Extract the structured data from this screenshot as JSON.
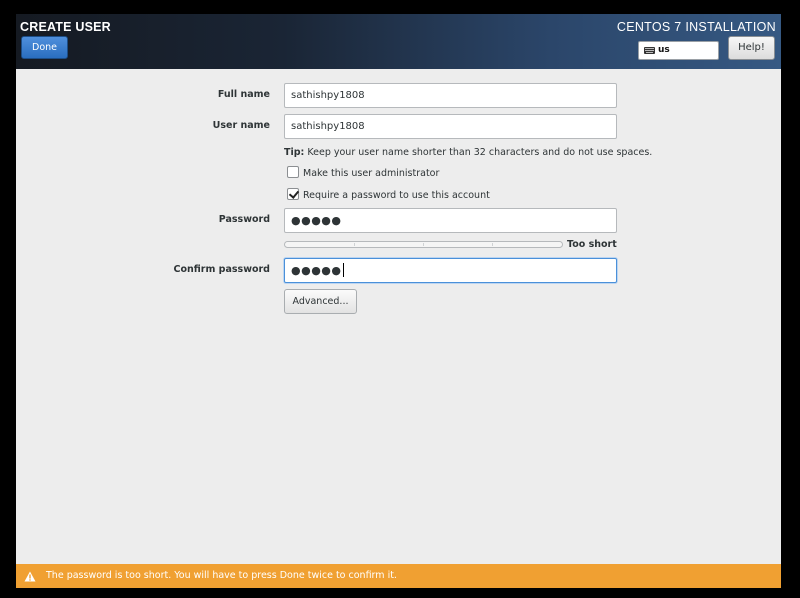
{
  "header": {
    "title": "CREATE USER",
    "done_label": "Done",
    "install_title": "CENTOS 7 INSTALLATION",
    "keyboard_layout": "us",
    "help_label": "Help!"
  },
  "form": {
    "full_name": {
      "label": "Full name",
      "value": "sathishpy1808"
    },
    "user_name": {
      "label": "User name",
      "value": "sathishpy1808"
    },
    "tip": {
      "prefix": "Tip:",
      "text": "Keep your user name shorter than 32 characters and do not use spaces."
    },
    "admin_checkbox": {
      "label": "Make this user administrator",
      "checked": false
    },
    "require_password_checkbox": {
      "label": "Require a password to use this account",
      "checked": true
    },
    "password": {
      "label": "Password",
      "masked_value": "●●●●●"
    },
    "strength": {
      "label": "Too short",
      "level_percent": 0
    },
    "confirm_password": {
      "label": "Confirm password",
      "masked_value": "●●●●●"
    },
    "advanced_label": "Advanced..."
  },
  "warning": {
    "icon": "warning-triangle-icon",
    "text": "The password is too short. You will have to press Done twice to confirm it.",
    "color": "#f0a032"
  }
}
